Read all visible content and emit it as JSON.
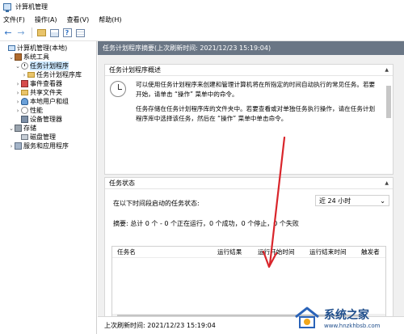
{
  "window": {
    "title": "计算机管理"
  },
  "menu": [
    "文件(F)",
    "操作(A)",
    "查看(V)",
    "帮助(H)"
  ],
  "toolbar": {
    "back_icon": "arrow-left-icon",
    "forward_icon": "arrow-right-icon"
  },
  "tree": [
    {
      "label": "计算机管理(本地)",
      "indent": 0,
      "twisty": "",
      "icon": "i-computer",
      "name": "tree-computer-management"
    },
    {
      "label": "系统工具",
      "indent": 1,
      "twisty": "⌄",
      "icon": "i-tools",
      "name": "tree-system-tools"
    },
    {
      "label": "任务计划程序",
      "indent": 2,
      "twisty": "⌄",
      "icon": "i-clock",
      "name": "tree-task-scheduler",
      "selected": true
    },
    {
      "label": "任务计划程序库",
      "indent": 3,
      "twisty": "›",
      "icon": "i-folder",
      "name": "tree-task-scheduler-library"
    },
    {
      "label": "事件查看器",
      "indent": 2,
      "twisty": "›",
      "icon": "i-event",
      "name": "tree-event-viewer"
    },
    {
      "label": "共享文件夹",
      "indent": 2,
      "twisty": "›",
      "icon": "i-share",
      "name": "tree-shared-folders"
    },
    {
      "label": "本地用户和组",
      "indent": 2,
      "twisty": "›",
      "icon": "i-users",
      "name": "tree-local-users-groups"
    },
    {
      "label": "性能",
      "indent": 2,
      "twisty": "›",
      "icon": "i-perf",
      "name": "tree-performance"
    },
    {
      "label": "设备管理器",
      "indent": 2,
      "twisty": "",
      "icon": "i-device",
      "name": "tree-device-manager"
    },
    {
      "label": "存储",
      "indent": 1,
      "twisty": "⌄",
      "icon": "i-storage",
      "name": "tree-storage"
    },
    {
      "label": "磁盘管理",
      "indent": 2,
      "twisty": "",
      "icon": "i-disk",
      "name": "tree-disk-management"
    },
    {
      "label": "服务和应用程序",
      "indent": 1,
      "twisty": "›",
      "icon": "i-services",
      "name": "tree-services-apps"
    }
  ],
  "pane": {
    "header": "任务计划程序摘要(上次刷新时间: 2021/12/23 15:19:04)",
    "overview": {
      "title": "任务计划程序概述",
      "para1": "可以使用任务计划程序来创建和管理计算机将在所指定的时间自动执行的常见任务。若要开始，请单击 “操作” 菜单中的命令。",
      "para2": "任务存储在任务计划程序库的文件夹中。若要查看或对单独任务执行操作，请在任务计划程序库中选择该任务，然后在 “操作” 菜单中单击命令。"
    },
    "status": {
      "title": "任务状态",
      "prompt": "在以下时间段启动的任务状态:",
      "dropdown_value": "近 24 小时",
      "summary": "摘要: 总计 0 个 - 0 个正在运行，0 个成功，0 个停止，0 个失败",
      "columns": [
        "任务名",
        "运行结果",
        "运行开始时间",
        "运行结束时间",
        "触发者"
      ]
    },
    "footer": "上次刷新时间: 2021/12/23 15:19:04"
  },
  "watermark": {
    "cn": "系统之家",
    "url": "www.hnzkhbsb.com"
  },
  "colors": {
    "annotation": "#d9252b",
    "header_bg": "#6a7685",
    "selected": "#cce8ff"
  }
}
